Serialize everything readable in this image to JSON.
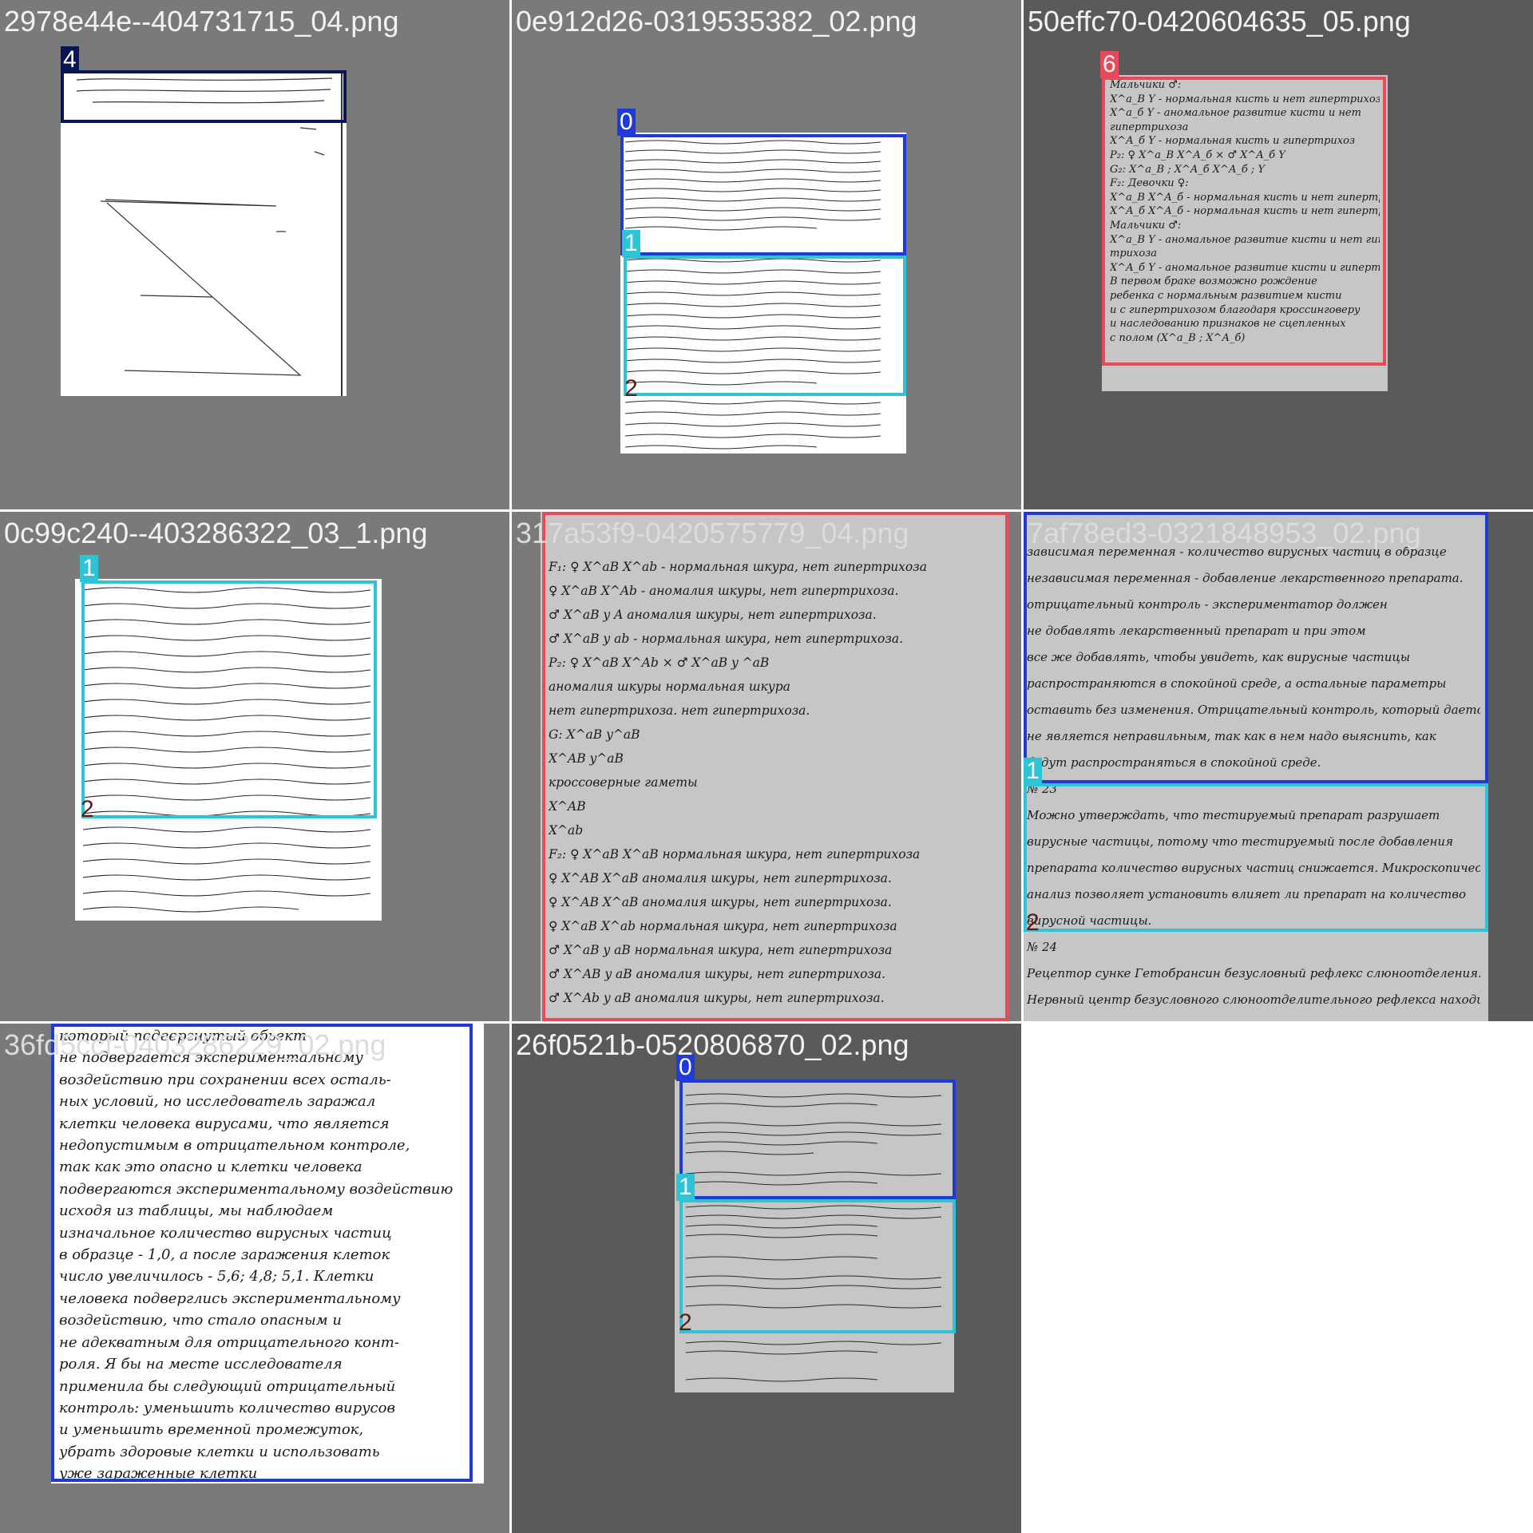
{
  "colors": {
    "class_0": "#1f3ad8",
    "class_1": "#2ec4d8",
    "class_2": "#5a1e14",
    "class_4": "#0a1650",
    "class_6": "#e84a5a"
  },
  "tiles": [
    {
      "filename": "2978e44e--404731715_04.png",
      "labels": [
        "4"
      ]
    },
    {
      "filename": "0e912d26-0319535382_02.png",
      "labels": [
        "0",
        "1",
        "2"
      ]
    },
    {
      "filename": "50effc70-0420604635_05.png",
      "labels": [
        "6"
      ]
    },
    {
      "filename": "0c99c240--403286322_03_1.png",
      "labels": [
        "1",
        "2"
      ]
    },
    {
      "filename": "317a53f9-0420575779_04.png",
      "labels": [
        "6"
      ]
    },
    {
      "filename": "7af78ed3-0321848953_02.png",
      "labels": [
        "0",
        "1",
        "2"
      ]
    },
    {
      "filename": "36fd5ccf-0403286229_02.png",
      "labels": [
        "0"
      ]
    },
    {
      "filename": "26f0521b-0520806870_02.png",
      "labels": [
        "0",
        "1",
        "2"
      ]
    }
  ],
  "text": {
    "t2_lines": [
      "Мальчики ♂:",
      "X^a_B Y - нормальная кисть и нет гипертрихоза",
      "X^a_б Y - аномальное развитие кисти и нет",
      "гипертрихоза",
      "X^A_б Y - нормальная кисть и гипертрихоз",
      "P₂: ♀ X^a_B X^A_б × ♂ X^A_б Y",
      "G₂: X^a_B ; X^A_б       X^A_б ; Y",
      "F₂: Девочки ♀:",
      "X^a_B X^A_б - нормальная кисть и нет гипертрихоза",
      "X^A_б X^A_б - нормальная кисть и нет гипертрихоза",
      "Мальчики ♂:",
      "X^a_B Y - аномальное развитие кисти и нет гипер-",
      "трихоза",
      "X^A_б Y - аномальное развитие кисти и гипертрихоз",
      "В первом браке возможно рождение",
      "ребенка с нормальным развитием кисти",
      "и с гипертрихозом благодаря кроссинговеру",
      "и наследованию признаков не сцепленных",
      "с полом (X^a_B ; X^A_б)"
    ],
    "t4_lines": [
      "F₁: ♀ X^aB X^ab - нормальная шкура, нет гипертрихоза",
      "♀ X^aB X^Ab - аномалия шкуры, нет гипертрихоза.",
      "♂ X^aB y A аномалия шкуры, нет гипертрихоза.",
      "♂ X^aB y ab - нормальная шкура, нет гипертрихоза.",
      "P₂: ♀ X^aB X^Ab      ×      ♂ X^aB y ^aB",
      "аномалия шкуры          нормальная шкура",
      "нет гипертрихоза.        нет гипертрихоза.",
      "G: X^aB                  y^aB",
      "X^AB                     y^aB",
      "кроссоверные гаметы",
      "X^AB",
      "X^ab",
      "F₂: ♀ X^aB X^aB  нормальная шкура, нет гипертрихоза",
      "♀ X^AB X^aB  аномалия шкуры, нет гипертрихоза.",
      "♀ X^AB X^aB  аномалия шкуры, нет гипертрихоза.",
      "♀ X^aB X^ab  нормальная шкура, нет гипертрихоза",
      "♂ X^aB y aB  нормальная шкура, нет гипертрихоза",
      "♂ X^AB y aB  аномалия шкуры, нет гипертрихоза.",
      "♂ X^Ab y aB  аномалия шкуры, нет гипертрихоза."
    ],
    "t5_lines": [
      "зависимая переменная - количество вирусных частиц в образце",
      "независимая переменная - добавление лекарственного препарата.",
      "отрицательный контроль - экспериментатор должен",
      "не добавлять лекарственный препарат и при этом",
      "все же добавлять, чтобы увидеть, как вирусные частицы",
      "распространяются в спокойной среде, а остальные параметры",
      "оставить без изменения. Отрицательный контроль, который дается",
      "не является неправильным, так как в нем надо выяснить, как",
      "будут распространяться в спокойной среде.",
      "№ 23",
      "Можно утверждать, что тестируемый препарат разрушает",
      "вирусные частицы, потому что тестируемый после добавления",
      "препарата количество вирусных частиц снижается. Микроскопический",
      "анализ позволяет установить влияет ли препарат на количество",
      "вирусной частицы.",
      "№ 24",
      "Рецептор сунке Гетобрансин безусловный рефлекс слюноотделения.",
      "Нервный центр безусловного слюноотделительного рефлекса находится в"
    ],
    "t6_lines": [
      "который подвергнутый обьект",
      "не подвергается экспериментальному",
      "воздействию при сохранении всех осталь-",
      "ных условий, но исследователь заражал",
      "клетки человека вирусами, что является",
      "недопустимым в отрицательном контроле,",
      "так как это опасно и клетки человека",
      "подвергаются экспериментальному воздействию",
      "исходя из таблицы, мы наблюдаем",
      "изначальное количество вирусных частиц",
      "в образце - 1,0, а после заражения клеток",
      "число увеличилось - 5,6; 4,8; 5,1. Клетки",
      "человека подверглись экспериментальному",
      "воздействию, что стало опасным и",
      "не адекватным для отрицательного конт-",
      "роля. Я бы на месте исследователя",
      "применила бы следующий отрицательный",
      "контроль: уменьшить количество вирусов",
      "и уменьшить временной промежуток,",
      "убрать здоровые клетки и использовать",
      "уже зараженные клетки"
    ]
  }
}
